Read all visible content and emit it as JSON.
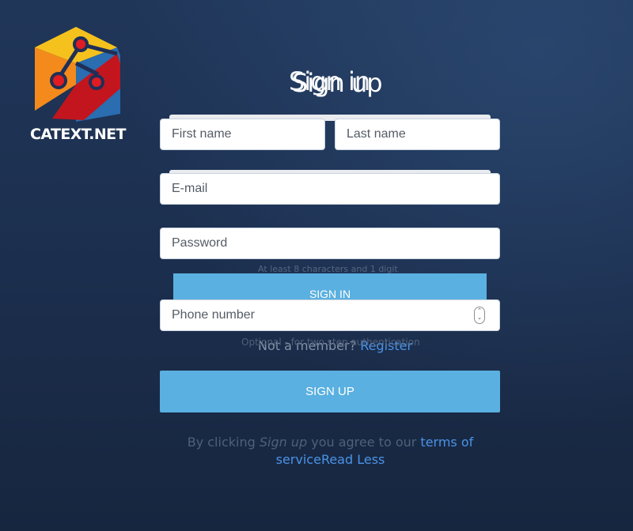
{
  "brand": {
    "logo_text": "CATEXT.NET",
    "colors": {
      "yellow": "#f5c11d",
      "orange": "#f48a1b",
      "red": "#c3151d",
      "blue": "#2a6db0"
    }
  },
  "ghost": {
    "title": "Sign in",
    "password_hint": "At least 8 characters and 1 digit",
    "signin_label": "SIGN IN",
    "not_member_text": "Not a member?",
    "register_link": "Register"
  },
  "signup": {
    "title": "Sign up",
    "first_name_placeholder": "First name",
    "last_name_placeholder": "Last name",
    "email_placeholder": "E-mail",
    "password_placeholder": "Password",
    "phone_placeholder": "Phone number",
    "phone_hint": "Optional - for two step authentication",
    "button_label": "SIGN UP",
    "terms_prefix": "By clicking",
    "terms_em": "Sign up",
    "terms_middle": "you agree to our",
    "terms_link": "terms of service",
    "read_less": "Read Less"
  },
  "colors": {
    "accent": "#5ab0e0",
    "link": "#4b93e6",
    "background": "#1c2f4f"
  }
}
